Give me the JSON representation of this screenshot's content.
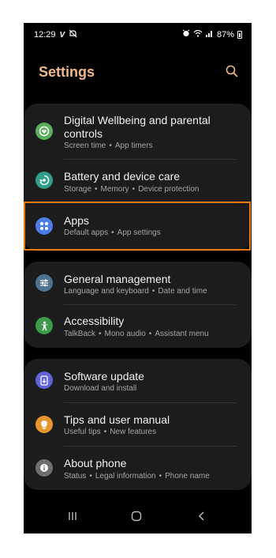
{
  "status_bar": {
    "time": "12:29",
    "battery_percent": "87%",
    "icons": [
      "v-app-icon",
      "mute-icon",
      "alarm-icon",
      "wifi-icon",
      "signal-icon",
      "battery-icon"
    ]
  },
  "header": {
    "title": "Settings",
    "search_icon": "search-icon"
  },
  "groups": [
    {
      "items": [
        {
          "title": "Digital Wellbeing and parental controls",
          "subtitle": [
            "Screen time",
            "App timers"
          ],
          "icon": "digital-wellbeing-icon",
          "icon_color": "#5cae5e"
        },
        {
          "title": "Battery and device care",
          "subtitle": [
            "Storage",
            "Memory",
            "Device protection"
          ],
          "icon": "device-care-icon",
          "icon_color": "#2f9f8a"
        },
        {
          "title": "Apps",
          "subtitle": [
            "Default apps",
            "App settings"
          ],
          "icon": "apps-icon",
          "icon_color": "#4d7ee8",
          "highlighted": true
        }
      ]
    },
    {
      "items": [
        {
          "title": "General management",
          "subtitle": [
            "Language and keyboard",
            "Date and time"
          ],
          "icon": "general-management-icon",
          "icon_color": "#4f7390"
        },
        {
          "title": "Accessibility",
          "subtitle": [
            "TalkBack",
            "Mono audio",
            "Assistant menu"
          ],
          "icon": "accessibility-icon",
          "icon_color": "#3c9a49"
        }
      ]
    },
    {
      "items": [
        {
          "title": "Software update",
          "subtitle": [
            "Download and install"
          ],
          "icon": "software-update-icon",
          "icon_color": "#5f62d8"
        },
        {
          "title": "Tips and user manual",
          "subtitle": [
            "Useful tips",
            "New features"
          ],
          "icon": "tips-icon",
          "icon_color": "#e6962f"
        },
        {
          "title": "About phone",
          "subtitle": [
            "Status",
            "Legal information",
            "Phone name"
          ],
          "icon": "info-icon",
          "icon_color": "#6e6e6e"
        }
      ]
    }
  ],
  "nav_bar": {
    "buttons": [
      "recents-icon",
      "home-icon",
      "back-icon"
    ]
  },
  "colors": {
    "accent_title": "#f2b889",
    "card_background": "#1c1c1c",
    "highlight_border": "#e8790f"
  }
}
